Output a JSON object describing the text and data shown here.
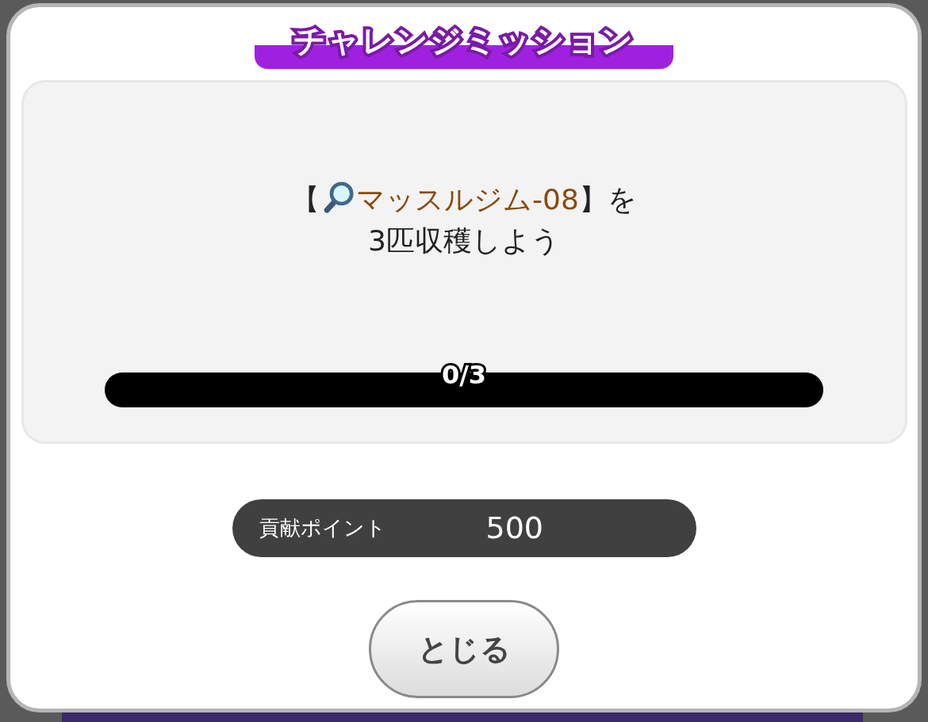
{
  "dialog": {
    "title": "チャレンジミッション",
    "mission": {
      "prefix": "【",
      "target": "マッスルジム-08",
      "suffix": "】を",
      "line_2": "3匹収穫しよう"
    },
    "progress": {
      "level": 0,
      "reading": "0/3"
    },
    "reward": {
      "label": "貢献ポイント",
      "value": "500"
    },
    "buttons": [
      "とじる"
    ]
  }
}
